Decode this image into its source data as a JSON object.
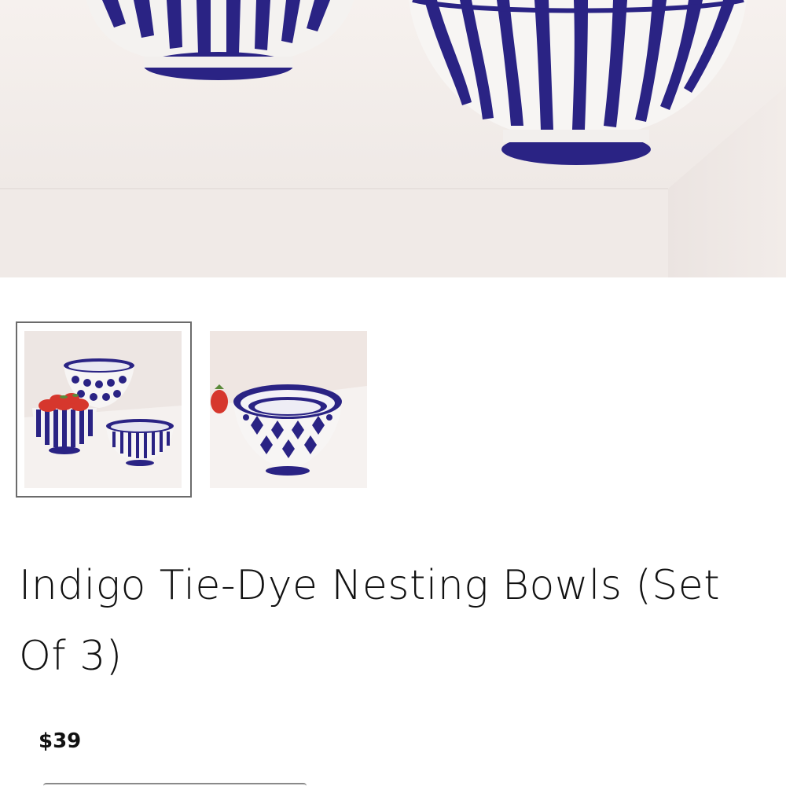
{
  "product": {
    "title": "Indigo Tie-Dye Nesting Bowls (Set Of 3)",
    "price": "$39"
  },
  "gallery": {
    "selected_index": 0,
    "thumbnails": [
      "bowls set with strawberries",
      "nested bowls with strawberry"
    ]
  },
  "colors": {
    "indigo": "#2a2384",
    "background": "#f3eeeb",
    "text": "#111111",
    "selected_border": "#6b6b6b"
  }
}
